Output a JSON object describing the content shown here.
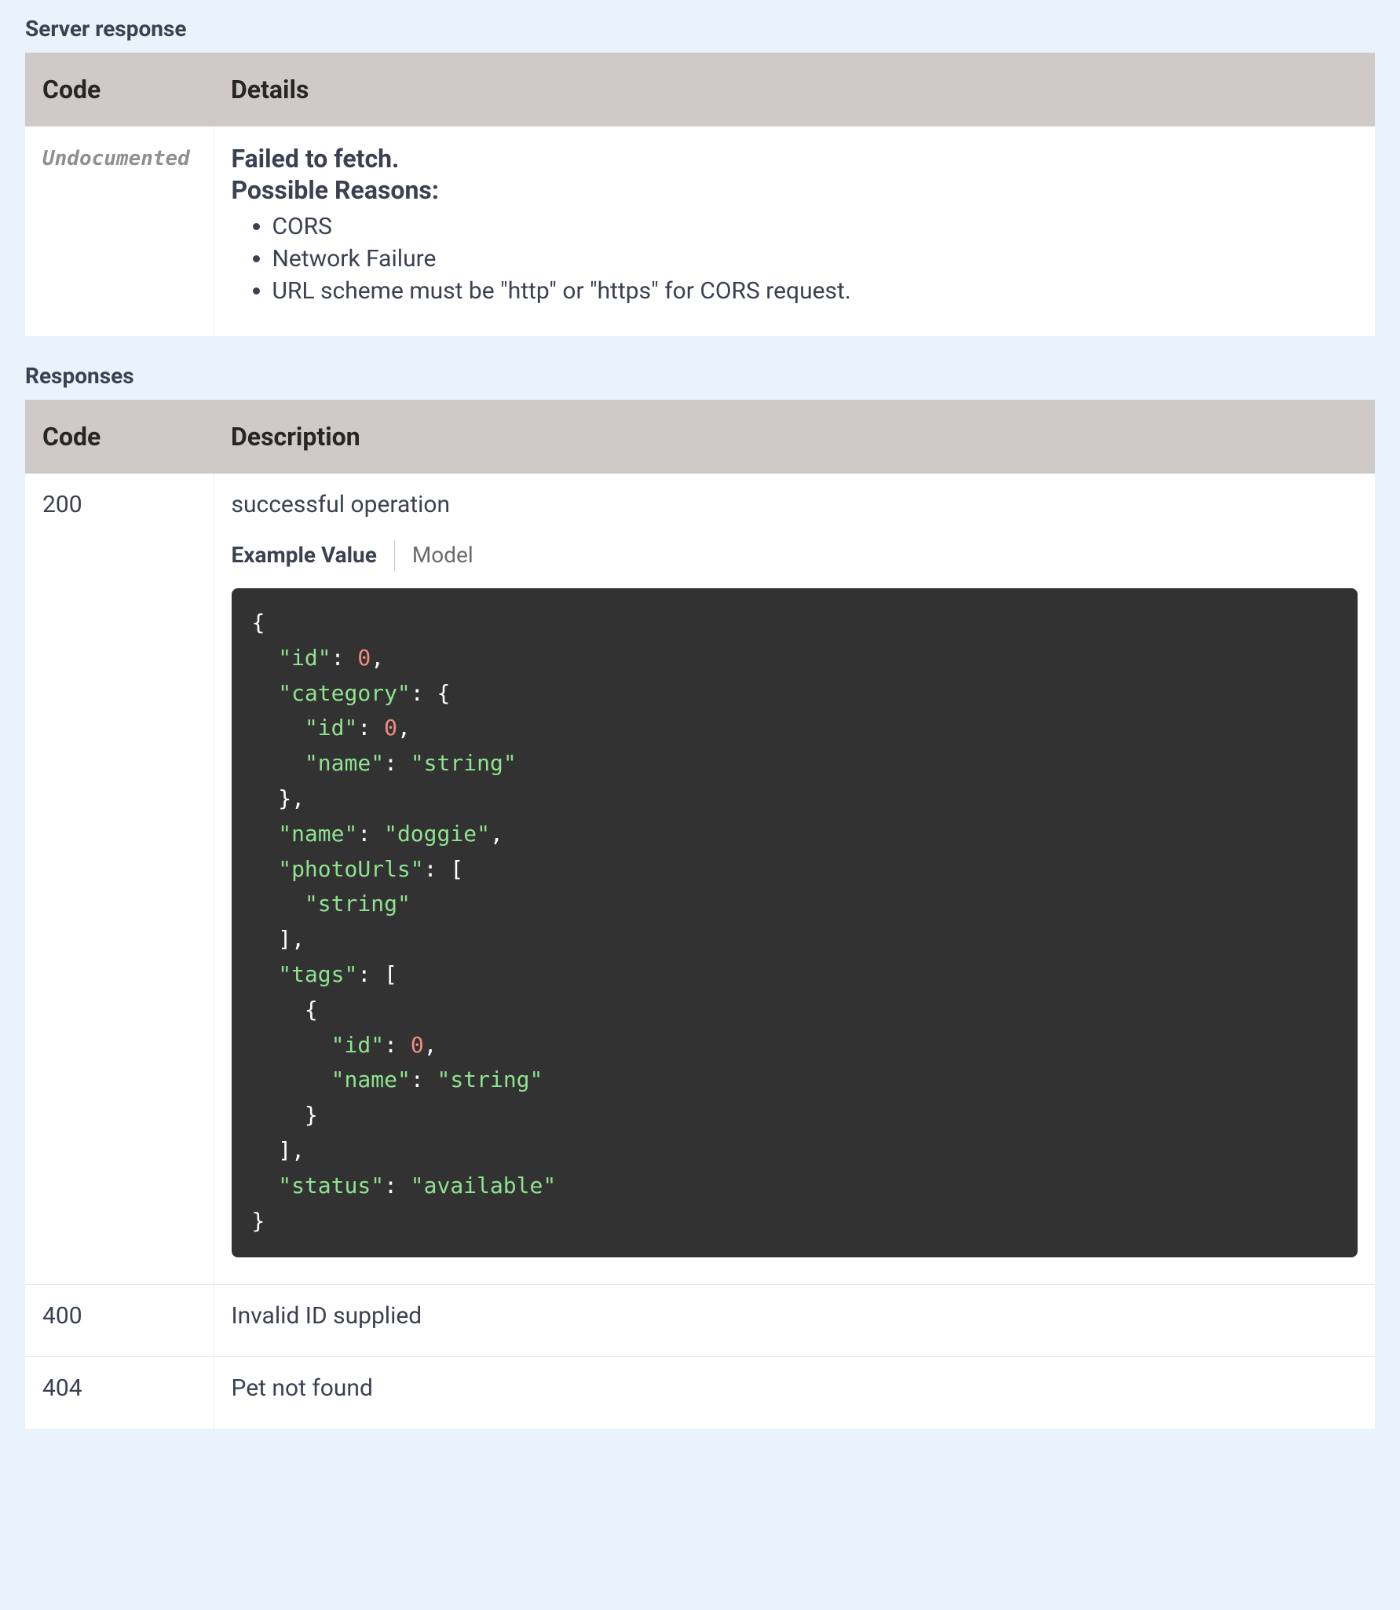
{
  "server_response": {
    "title": "Server response",
    "col_code": "Code",
    "col_details": "Details",
    "row": {
      "code_label": "Undocumented",
      "error_title": "Failed to fetch.",
      "error_subtitle": "Possible Reasons:",
      "reasons": [
        "CORS",
        "Network Failure",
        "URL scheme must be \"http\" or \"https\" for CORS request."
      ]
    }
  },
  "responses": {
    "title": "Responses",
    "col_code": "Code",
    "col_description": "Description",
    "tabs": {
      "example_value": "Example Value",
      "model": "Model"
    },
    "rows": [
      {
        "code": "200",
        "description": "successful operation",
        "has_example": true,
        "example_tokens": [
          {
            "t": "plain",
            "v": "{\n  "
          },
          {
            "t": "str",
            "v": "\"id\""
          },
          {
            "t": "plain",
            "v": ": "
          },
          {
            "t": "num",
            "v": "0"
          },
          {
            "t": "plain",
            "v": ",\n  "
          },
          {
            "t": "str",
            "v": "\"category\""
          },
          {
            "t": "plain",
            "v": ": {\n    "
          },
          {
            "t": "str",
            "v": "\"id\""
          },
          {
            "t": "plain",
            "v": ": "
          },
          {
            "t": "num",
            "v": "0"
          },
          {
            "t": "plain",
            "v": ",\n    "
          },
          {
            "t": "str",
            "v": "\"name\""
          },
          {
            "t": "plain",
            "v": ": "
          },
          {
            "t": "str",
            "v": "\"string\""
          },
          {
            "t": "plain",
            "v": "\n  },\n  "
          },
          {
            "t": "str",
            "v": "\"name\""
          },
          {
            "t": "plain",
            "v": ": "
          },
          {
            "t": "str",
            "v": "\"doggie\""
          },
          {
            "t": "plain",
            "v": ",\n  "
          },
          {
            "t": "str",
            "v": "\"photoUrls\""
          },
          {
            "t": "plain",
            "v": ": [\n    "
          },
          {
            "t": "str",
            "v": "\"string\""
          },
          {
            "t": "plain",
            "v": "\n  ],\n  "
          },
          {
            "t": "str",
            "v": "\"tags\""
          },
          {
            "t": "plain",
            "v": ": [\n    {\n      "
          },
          {
            "t": "str",
            "v": "\"id\""
          },
          {
            "t": "plain",
            "v": ": "
          },
          {
            "t": "num",
            "v": "0"
          },
          {
            "t": "plain",
            "v": ",\n      "
          },
          {
            "t": "str",
            "v": "\"name\""
          },
          {
            "t": "plain",
            "v": ": "
          },
          {
            "t": "str",
            "v": "\"string\""
          },
          {
            "t": "plain",
            "v": "\n    }\n  ],\n  "
          },
          {
            "t": "str",
            "v": "\"status\""
          },
          {
            "t": "plain",
            "v": ": "
          },
          {
            "t": "str",
            "v": "\"available\""
          },
          {
            "t": "plain",
            "v": "\n}"
          }
        ]
      },
      {
        "code": "400",
        "description": "Invalid ID supplied",
        "has_example": false
      },
      {
        "code": "404",
        "description": "Pet not found",
        "has_example": false
      }
    ]
  }
}
